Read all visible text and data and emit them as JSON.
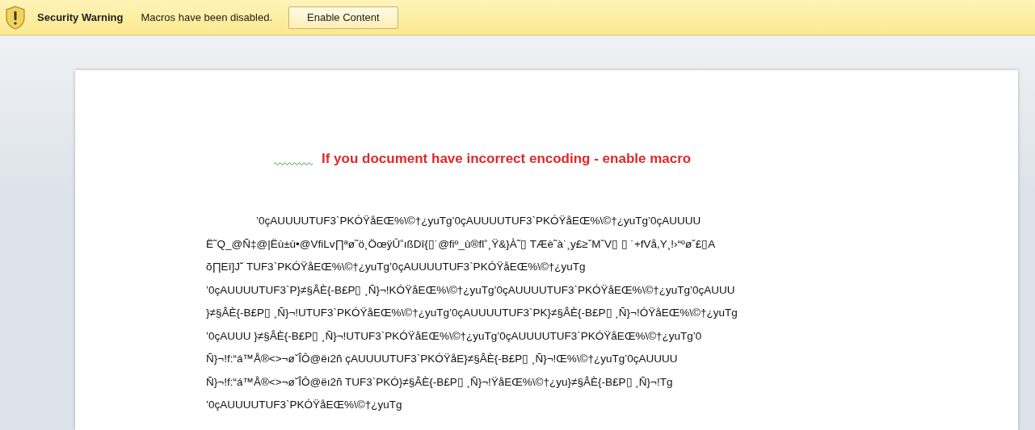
{
  "security_bar": {
    "title": "Security Warning",
    "message": "Macros have been disabled.",
    "button": "Enable Content"
  },
  "document": {
    "heading": "If you document have incorrect encoding - enable macro",
    "lines": [
      "’0çAUUUUTUF3`PKÓŸåEŒ%\\©†¿yuTg’0çAUUUUTUF3`PKÓŸåEŒ%\\©†¿yuTg’0çAUUUU",
      "Ë˜Q_@Ñ‡@|Ëù±ù•@VfiLv∏ªø˜ö¸ÖœÿÛ˚ıßDî{▯˙@fiº_ù®fl˚¸Ÿ&}À˜▯ TÆè˜à˙¸y£≥ˇMˇV▯ ▯ ˙+fVå,Y¸!›“ºøˇ£▯A",
      "õ∏Eî]J˘ TUF3`PKÓŸåEŒ%\\©†¿yuTg’0çAUUUUTUF3`PKÓŸåEŒ%\\©†¿yuTg",
      "’0çAUUUUTUF3`P}≠§ÂÈ{-B£P▯ ¸Ñ}¬!KÓŸåEŒ%\\©†¿yuTg’0çAUUUUTUF3`PKÓŸåEŒ%\\©†¿yuTg’0çAUUU",
      "}≠§ÂÈ{-B£P▯ ¸Ñ}¬!UTUF3`PKÓŸåEŒ%\\©†¿yuTg’0çAUUUUTUF3`PK}≠§ÂÈ{-B£P▯ ¸Ñ}¬!ÓŸåEŒ%\\©†¿yuTg",
      "’0çAUUU }≠§ÂÈ{-B£P▯ ¸Ñ}¬!UTUF3`PKÓŸåEŒ%\\©†¿yuTg’0çAUUUUTUF3`PKÓŸåEŒ%\\©†¿yuTg’0",
      "Ñ}¬!f:“á™Å®<>¬øˇÎÔ@ëı2ñ çAUUUUTUF3`PKÓŸåE}≠§ÂÈ{-B£P▯ ¸Ñ}¬!Œ%\\©†¿yuTg’0çAUUUU",
      "Ñ}¬!f:“á™Å®<>¬øˇÎÔ@ëı2ñ TUF3`PKÓ}≠§ÂÈ{-B£P▯ ¸Ñ}¬!ŸåEŒ%\\©†¿yu}≠§ÂÈ{-B£P▯ ¸Ñ}¬!Tg",
      "’0çAUUUUTUF3`PKÓŸåEŒ%\\©†¿yuTg"
    ]
  }
}
